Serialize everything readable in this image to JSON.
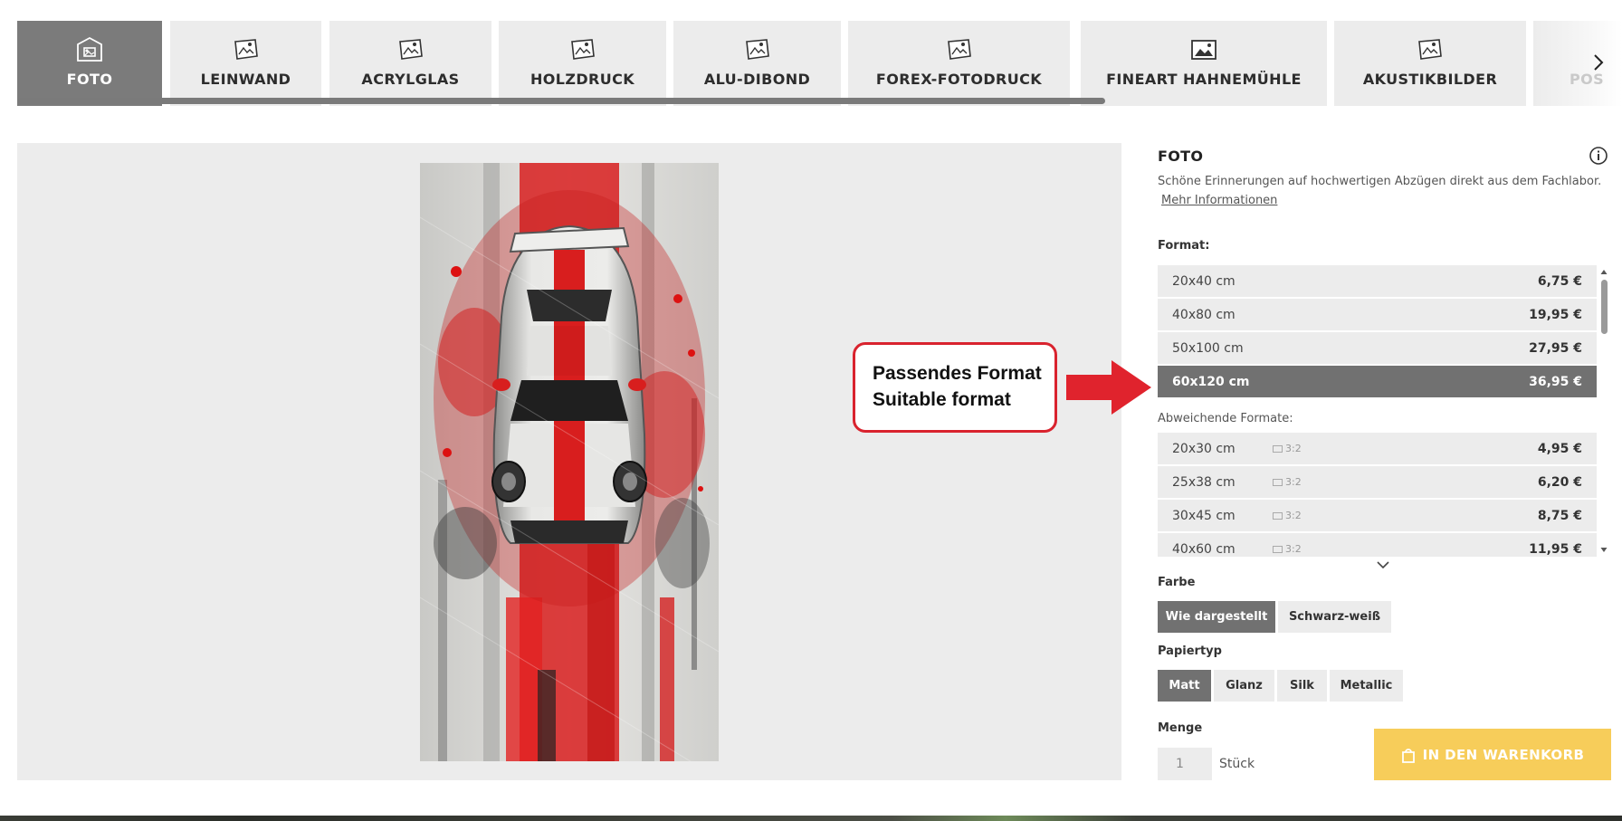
{
  "tabs": [
    {
      "label": "FOTO",
      "icon": "photo-print-icon",
      "active": true
    },
    {
      "label": "LEINWAND",
      "icon": "canvas-icon",
      "active": false
    },
    {
      "label": "ACRYLGLAS",
      "icon": "acrylic-icon",
      "active": false
    },
    {
      "label": "HOLZDRUCK",
      "icon": "wood-print-icon",
      "active": false
    },
    {
      "label": "ALU-DIBOND",
      "icon": "alu-dibond-icon",
      "active": false
    },
    {
      "label": "FOREX-FOTODRUCK",
      "icon": "forex-icon",
      "active": false
    },
    {
      "label": "FINEART HAHNEMÜHLE",
      "icon": "fineart-icon",
      "active": false
    },
    {
      "label": "AKUSTIKBILDER",
      "icon": "acoustic-icon",
      "active": false
    },
    {
      "label": "POS",
      "icon": "poster-icon",
      "active": false
    }
  ],
  "annotation": {
    "line1": "Passendes Format",
    "line2": "Suitable format",
    "color": "#d9232e"
  },
  "product": {
    "title": "FOTO",
    "description": "Schöne Erinnerungen auf hochwertigen Abzügen direkt aus dem Fachlabor. ...",
    "more_link": "Mehr Informationen"
  },
  "format": {
    "label": "Format:",
    "options": [
      {
        "size": "20x40 cm",
        "price": "6,75 €",
        "selected": false
      },
      {
        "size": "40x80 cm",
        "price": "19,95 €",
        "selected": false
      },
      {
        "size": "50x100 cm",
        "price": "27,95 €",
        "selected": false
      },
      {
        "size": "60x120 cm",
        "price": "36,95 €",
        "selected": true
      }
    ],
    "alt_label": "Abweichende Formate:",
    "alt_options": [
      {
        "size": "20x30 cm",
        "ratio": "3:2",
        "price": "4,95 €"
      },
      {
        "size": "25x38 cm",
        "ratio": "3:2",
        "price": "6,20 €"
      },
      {
        "size": "30x45 cm",
        "ratio": "3:2",
        "price": "8,75 €"
      },
      {
        "size": "40x60 cm",
        "ratio": "3:2",
        "price": "11,95 €"
      }
    ]
  },
  "color": {
    "label": "Farbe",
    "options": [
      "Wie dargestellt",
      "Schwarz-weiß"
    ],
    "selected": "Wie dargestellt"
  },
  "paper": {
    "label": "Papiertyp",
    "options": [
      "Matt",
      "Glanz",
      "Silk",
      "Metallic"
    ],
    "selected": "Matt"
  },
  "quantity": {
    "label": "Menge",
    "value": "1",
    "unit": "Stück"
  },
  "cart": {
    "label": "IN DEN WARENKORB",
    "icon": "shopping-bag-icon",
    "color": "#f7cd5a"
  },
  "theme": {
    "active_gray": "#7b7b7b",
    "tab_gray": "#ececec",
    "accent_red": "#e0232d"
  }
}
